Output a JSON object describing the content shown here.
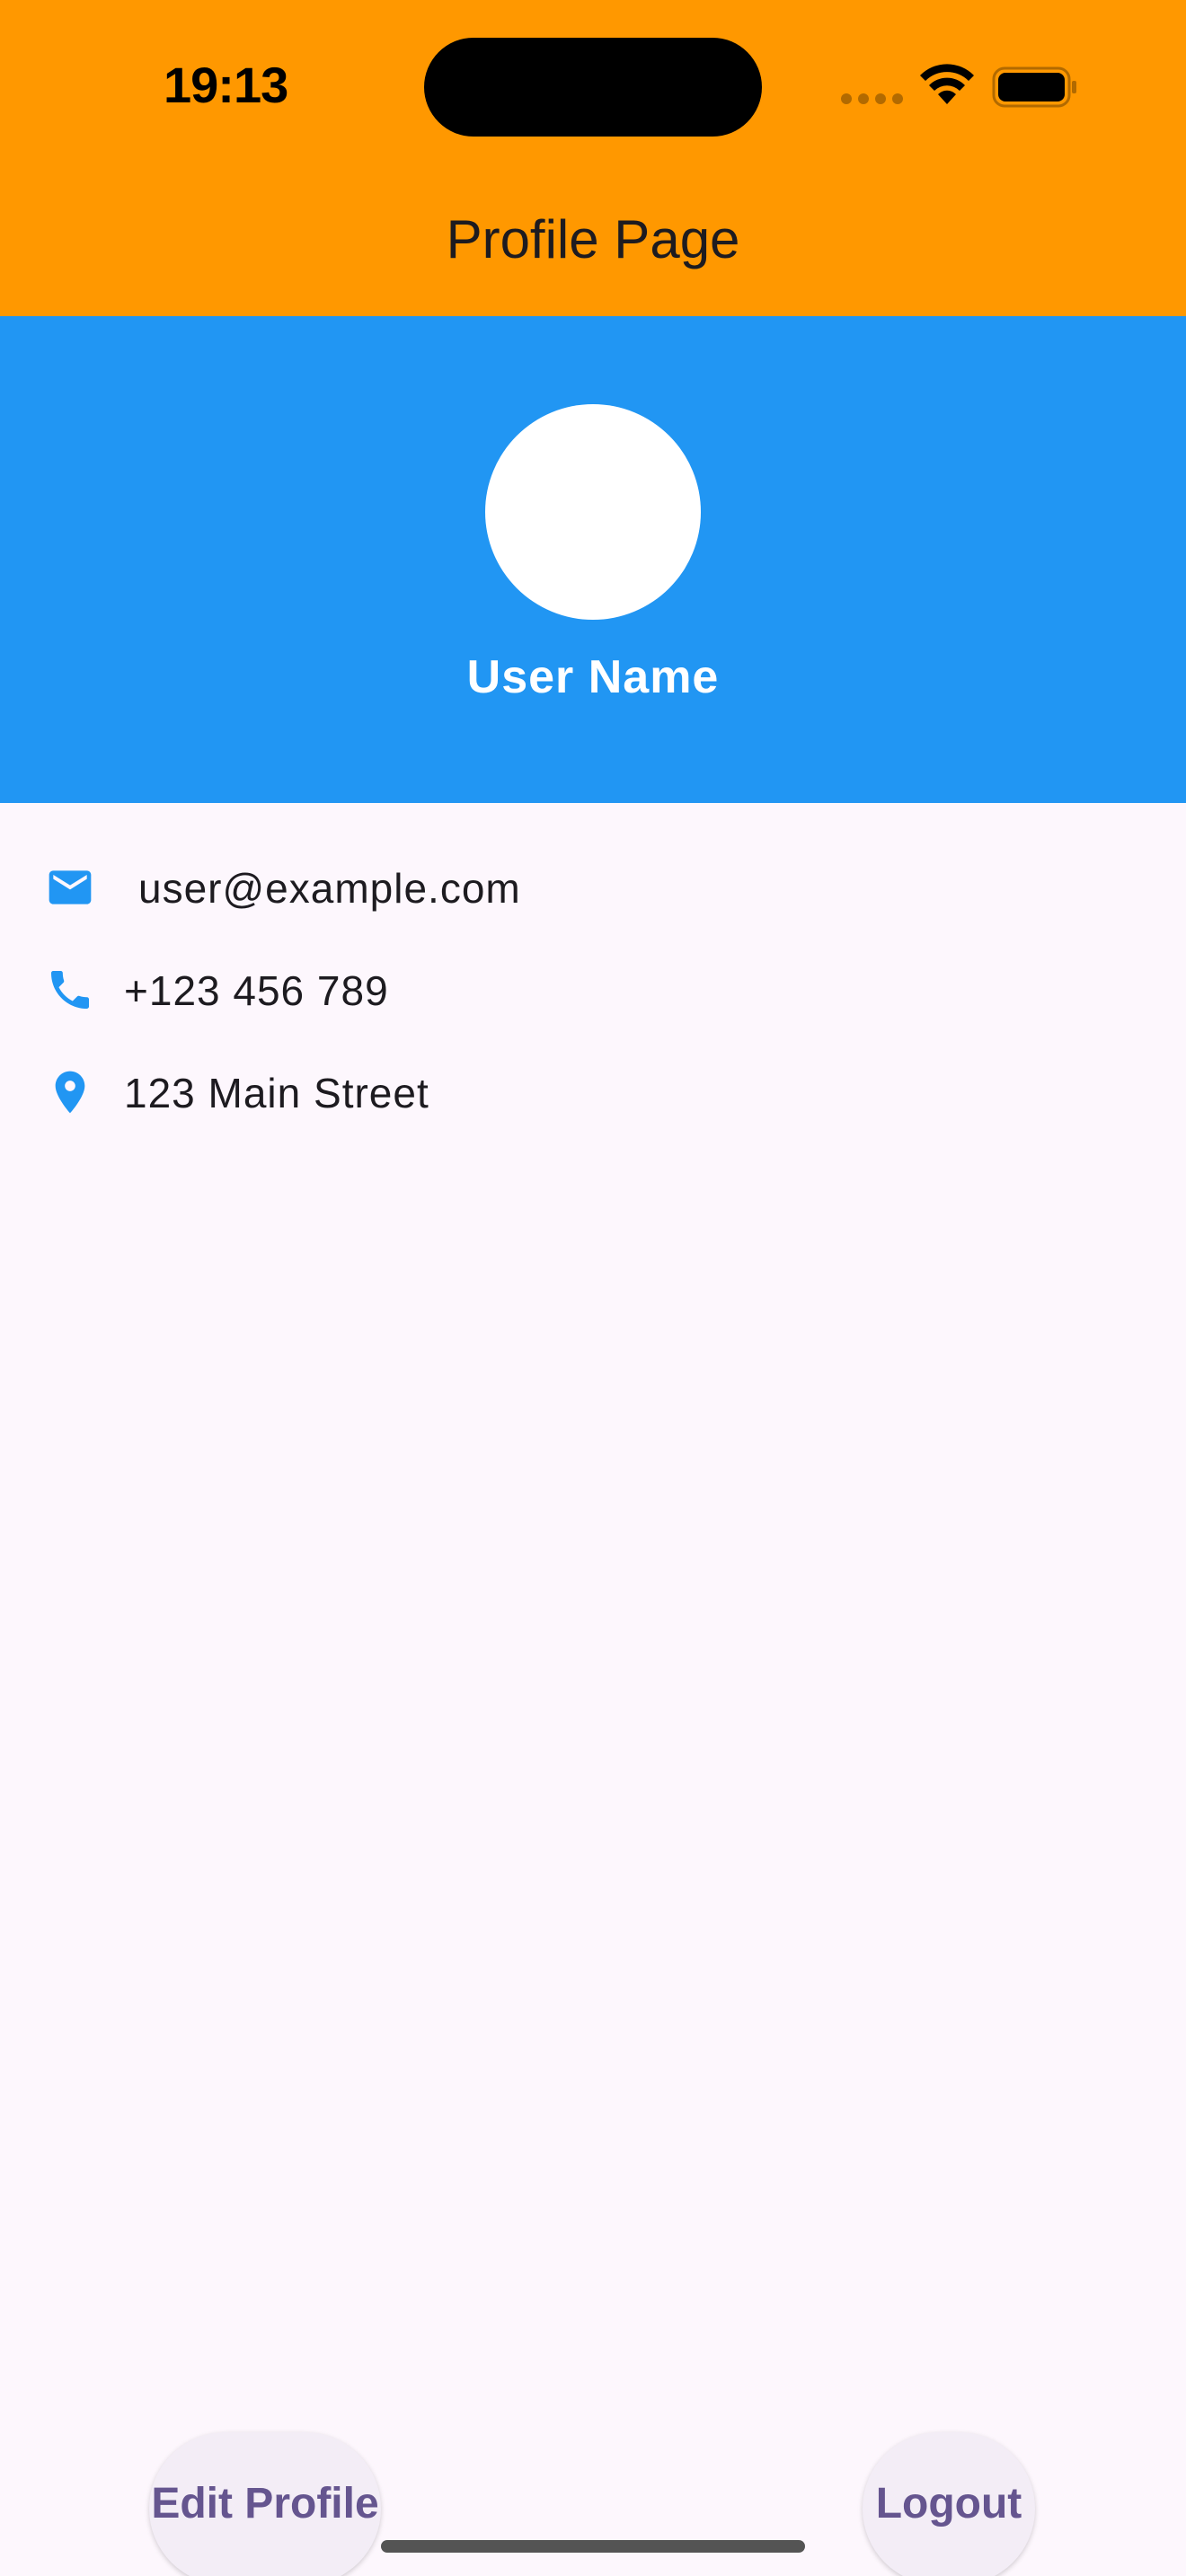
{
  "status_bar": {
    "time": "19:13"
  },
  "app_bar": {
    "title": "Profile Page",
    "color": "#ff9800"
  },
  "profile": {
    "user_name": "User Name",
    "header_color": "#2196f3",
    "avatar_icon": "avatar-circle"
  },
  "info": [
    {
      "icon": "email-icon",
      "text": "user@example.com"
    },
    {
      "icon": "phone-icon",
      "text": "+123 456 789"
    },
    {
      "icon": "location-pin-icon",
      "text": "123 Main Street"
    }
  ],
  "actions": {
    "edit_label": "Edit Profile",
    "logout_label": "Logout"
  },
  "accent_color": "#2196f3",
  "button_text_color": "#65558f"
}
